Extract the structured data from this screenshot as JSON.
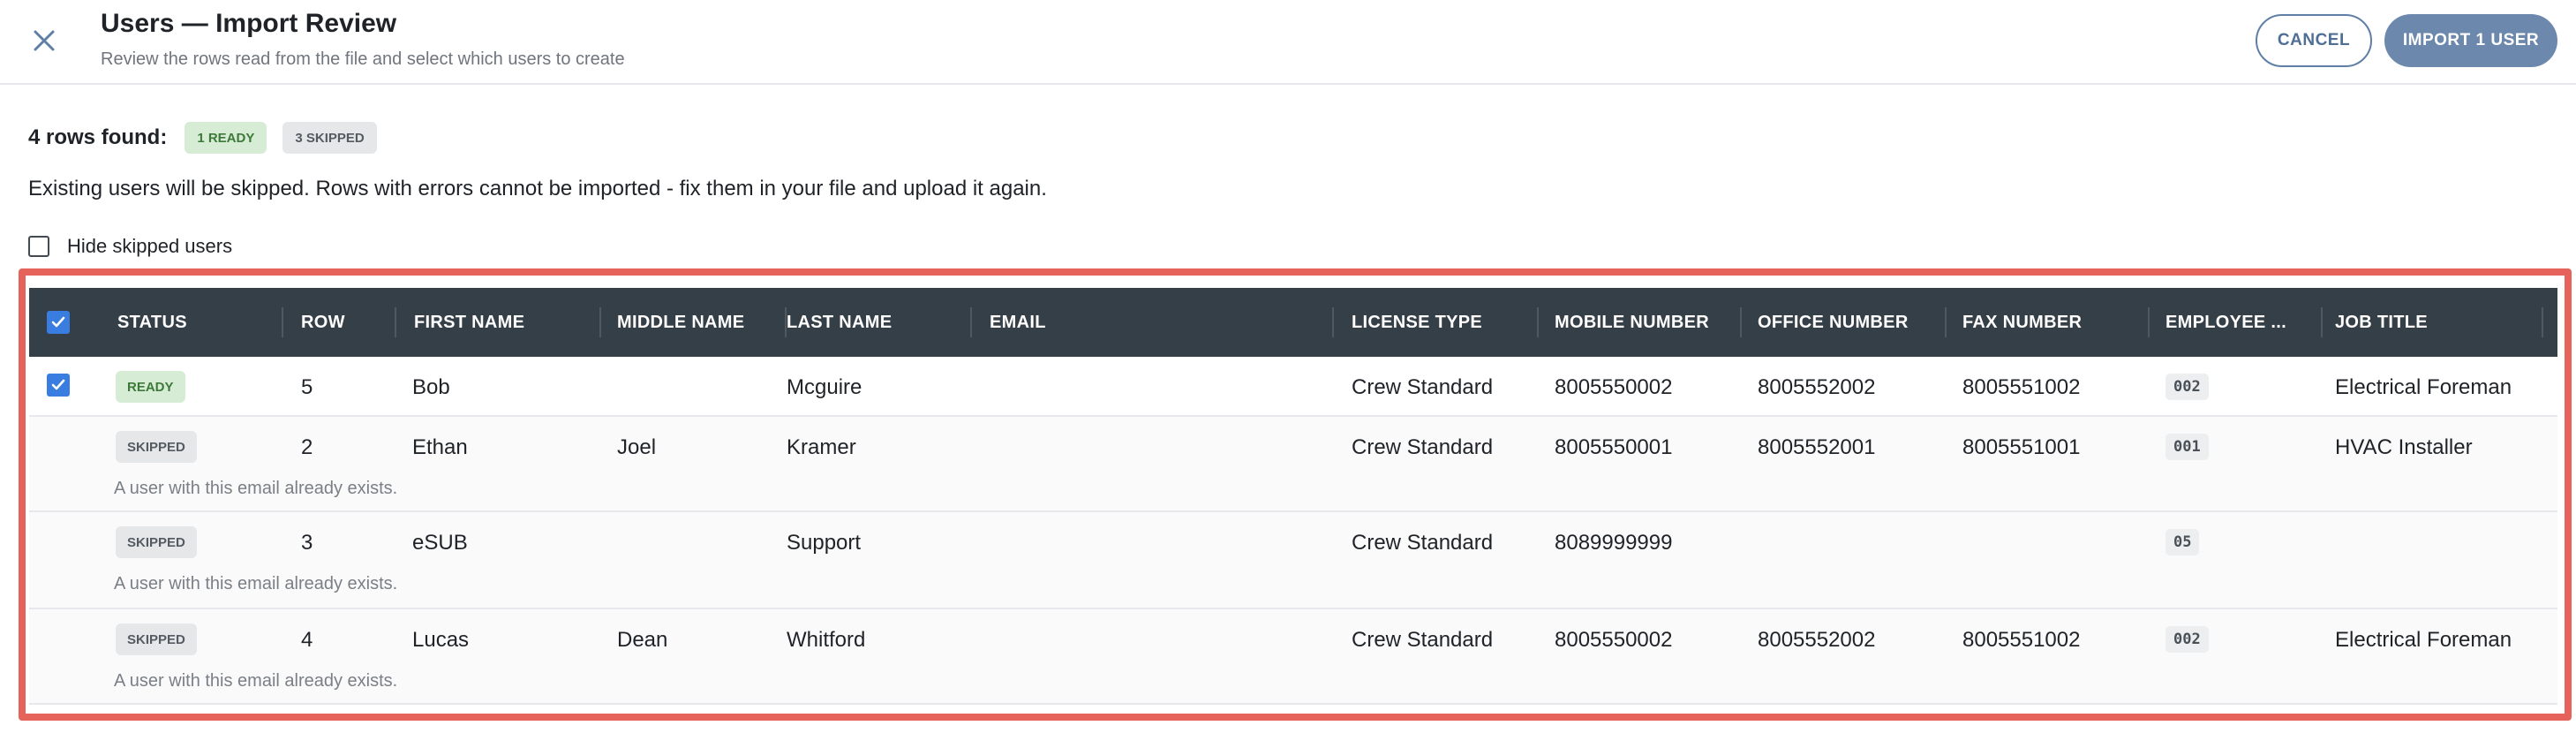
{
  "header": {
    "title": "Users — Import Review",
    "subtitle": "Review the rows read from the file and select which users to create",
    "cancel_label": "CANCEL",
    "import_label": "IMPORT 1 USER"
  },
  "summary": {
    "label": "4 rows found:",
    "ready_badge": "1 READY",
    "skipped_badge": "3 SKIPPED"
  },
  "notice": "Existing users will be skipped. Rows with errors cannot be imported - fix them in your file and upload it again.",
  "hide_skipped_label": "Hide skipped users",
  "table": {
    "columns": [
      "STATUS",
      "ROW",
      "FIRST NAME",
      "MIDDLE NAME",
      "LAST NAME",
      "EMAIL",
      "LICENSE TYPE",
      "MOBILE NUMBER",
      "OFFICE NUMBER",
      "FAX NUMBER",
      "EMPLOYEE ...",
      "JOB TITLE"
    ],
    "rows": [
      {
        "status": "READY",
        "row": "5",
        "first": "Bob",
        "middle": "",
        "last": "Mcguire",
        "email": "",
        "license": "Crew Standard",
        "mobile": "8005550002",
        "office": "8005552002",
        "fax": "8005551002",
        "employee": "002",
        "job": "Electrical Foreman",
        "message": ""
      },
      {
        "status": "SKIPPED",
        "row": "2",
        "first": "Ethan",
        "middle": "Joel",
        "last": "Kramer",
        "email": "",
        "license": "Crew Standard",
        "mobile": "8005550001",
        "office": "8005552001",
        "fax": "8005551001",
        "employee": "001",
        "job": "HVAC Installer",
        "message": "A user with this email already exists."
      },
      {
        "status": "SKIPPED",
        "row": "3",
        "first": "eSUB",
        "middle": "",
        "last": "Support",
        "email": "",
        "license": "Crew Standard",
        "mobile": "8089999999",
        "office": "",
        "fax": "",
        "employee": "05",
        "job": "",
        "message": "A user with this email already exists."
      },
      {
        "status": "SKIPPED",
        "row": "4",
        "first": "Lucas",
        "middle": "Dean",
        "last": "Whitford",
        "email": "",
        "license": "Crew Standard",
        "mobile": "8005550002",
        "office": "8005552002",
        "fax": "8005551002",
        "employee": "002",
        "job": "Electrical Foreman",
        "message": "A user with this email already exists."
      }
    ]
  },
  "colors": {
    "header_bg": "#353f47",
    "accent": "#3a7de0",
    "highlight_frame": "#e5635a",
    "ready_bg": "#d6ecd5",
    "ready_text": "#3d7a3a",
    "skipped_bg": "#e6e7e9",
    "skipped_text": "#555b63",
    "import_button": "#6c88ad"
  },
  "icons": {
    "close": "close-icon",
    "checkmark": "checkmark-icon"
  }
}
